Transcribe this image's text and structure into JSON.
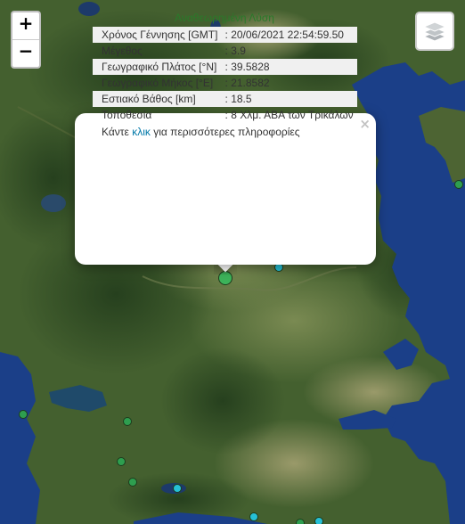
{
  "zoom": {
    "in_label": "+",
    "out_label": "−"
  },
  "layers_icon": "layers-icon",
  "popup": {
    "close_label": "×",
    "title": "Αναθεωρημένη Λύση",
    "rows": [
      {
        "label": "Χρόνος Γέννησης [GMT]",
        "value": ": 20/06/2021 22:54:59.50"
      },
      {
        "label": "Μέγεθος",
        "value": ": 3.9"
      },
      {
        "label": "Γεωγραφικό Πλάτος [°N]",
        "value": ": 39.5828"
      },
      {
        "label": "Γεωγραφικό Μήκος [°E]",
        "value": ": 21.8582"
      },
      {
        "label": "Εστιακό Βάθος [km]",
        "value": ": 18.5"
      },
      {
        "label": "Τοποθεσία",
        "value": ": 8 Χλμ. ΑΒΑ των Τρικάλων"
      }
    ],
    "more_prefix": "Κάντε ",
    "more_link": "κλικ",
    "more_suffix": " για περισσότερες πληροφορίες"
  },
  "colors": {
    "selected_marker": "#3db35a",
    "marker_green": "#2e9e4f",
    "marker_cyan": "#26c0d6",
    "sea": "#1a3f8a"
  }
}
